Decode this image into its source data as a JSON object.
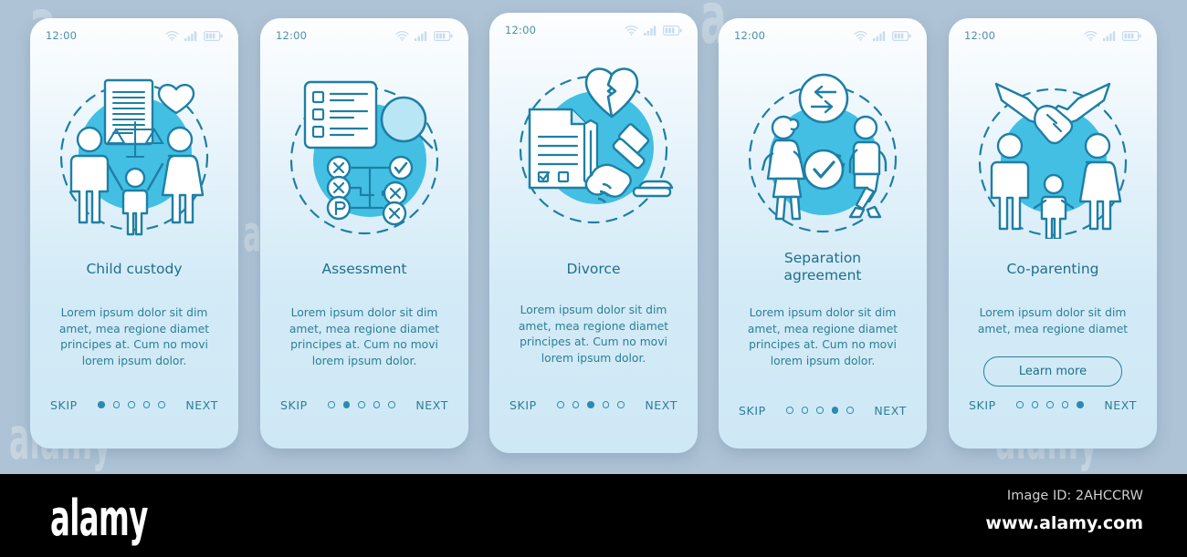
{
  "background_color": "#aec3d5",
  "accent_color": "#2b8bb0",
  "title_color": "#1f6f8b",
  "body_color": "#2d7e96",
  "circle_color": "#43bfe4",
  "status_bar": {
    "time": "12:00",
    "icons": [
      "wifi-icon",
      "cellular-signal-icon",
      "battery-icon"
    ]
  },
  "nav": {
    "skip_label": "SKIP",
    "next_label": "NEXT",
    "total_steps": 5
  },
  "screens": [
    {
      "id": "child-custody",
      "title": "Child custody",
      "title_lines": [
        "Child custody"
      ],
      "body": "Lorem ipsum dolor sit dim amet, mea regione diamet principes at. Cum no movi lorem ipsum dolor.",
      "illustration": "family-with-scales-of-justice-icon",
      "active_dot": 1,
      "cta": null
    },
    {
      "id": "assessment",
      "title": "Assessment",
      "title_lines": [
        "Assessment"
      ],
      "body": "Lorem ipsum dolor sit dim amet, mea regione diamet principes at. Cum no movi lorem ipsum dolor.",
      "illustration": "checklist-magnifier-decision-tree-icon",
      "active_dot": 2,
      "cta": null
    },
    {
      "id": "divorce",
      "title": "Divorce",
      "title_lines": [
        "Divorce"
      ],
      "body": "Lorem ipsum dolor sit dim amet, mea regione diamet principes at. Cum no movi lorem ipsum dolor.",
      "illustration": "broken-heart-gavel-document-icon",
      "active_dot": 3,
      "cta": null
    },
    {
      "id": "separation-agreement",
      "title": "Separation agreement",
      "title_lines": [
        "Separation",
        "agreement"
      ],
      "body": "Lorem ipsum dolor sit dim amet, mea regione diamet principes at. Cum no movi lorem ipsum dolor.",
      "illustration": "two-people-walking-apart-exchange-icon",
      "active_dot": 4,
      "cta": null
    },
    {
      "id": "co-parenting",
      "title": "Co-parenting",
      "title_lines": [
        "Co-parenting"
      ],
      "body": "Lorem ipsum dolor sit dim amet, mea regione diamet",
      "illustration": "handshake-over-family-icon",
      "active_dot": 5,
      "cta": "Learn more"
    }
  ],
  "watermark": {
    "brand": "alamy",
    "image_id": "Image ID: 2AHCCRW",
    "website": "www.alamy.com"
  }
}
